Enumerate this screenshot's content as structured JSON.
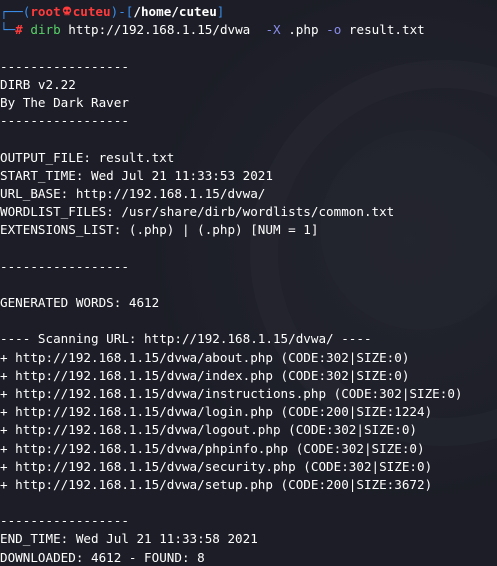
{
  "prompt": {
    "user": "root",
    "host": "cuteu",
    "path": "/home/cuteu",
    "open_bracket": "[",
    "close_bracket": "]",
    "separator": ")-",
    "open_paren": "(",
    "command": "dirb",
    "args_url": "http://192.168.1.15/dvwa",
    "flag_x": "-X",
    "ext": ".php",
    "flag_o": "-o",
    "outfile": "result.txt",
    "hash": "#"
  },
  "output": {
    "dashes": "-----------------",
    "banner_title": "DIRB v2.22",
    "banner_author": "By The Dark Raver",
    "output_file": "OUTPUT_FILE: result.txt",
    "start_time": "START_TIME: Wed Jul 21 11:33:53 2021",
    "url_base": "URL_BASE: http://192.168.1.15/dvwa/",
    "wordlist_files": "WORDLIST_FILES: /usr/share/dirb/wordlists/common.txt",
    "extensions_list": "EXTENSIONS_LIST: (.php) | (.php) [NUM = 1]",
    "generated_words": "GENERATED WORDS: 4612",
    "scanning_url": "---- Scanning URL: http://192.168.1.15/dvwa/ ----",
    "results": [
      "+ http://192.168.1.15/dvwa/about.php (CODE:302|SIZE:0)",
      "+ http://192.168.1.15/dvwa/index.php (CODE:302|SIZE:0)",
      "+ http://192.168.1.15/dvwa/instructions.php (CODE:302|SIZE:0)",
      "+ http://192.168.1.15/dvwa/login.php (CODE:200|SIZE:1224)",
      "+ http://192.168.1.15/dvwa/logout.php (CODE:302|SIZE:0)",
      "+ http://192.168.1.15/dvwa/phpinfo.php (CODE:302|SIZE:0)",
      "+ http://192.168.1.15/dvwa/security.php (CODE:302|SIZE:0)",
      "+ http://192.168.1.15/dvwa/setup.php (CODE:200|SIZE:3672)"
    ],
    "end_time": "END_TIME: Wed Jul 21 11:33:58 2021",
    "downloaded": "DOWNLOADED: 4612 - FOUND: 8"
  },
  "colors": {
    "background": "#1c1d26",
    "prompt_frame": "#3b8eea",
    "user_host": "#ff3b3b",
    "command": "#58d068",
    "flags": "#8a8de8",
    "text": "#ffffff"
  }
}
